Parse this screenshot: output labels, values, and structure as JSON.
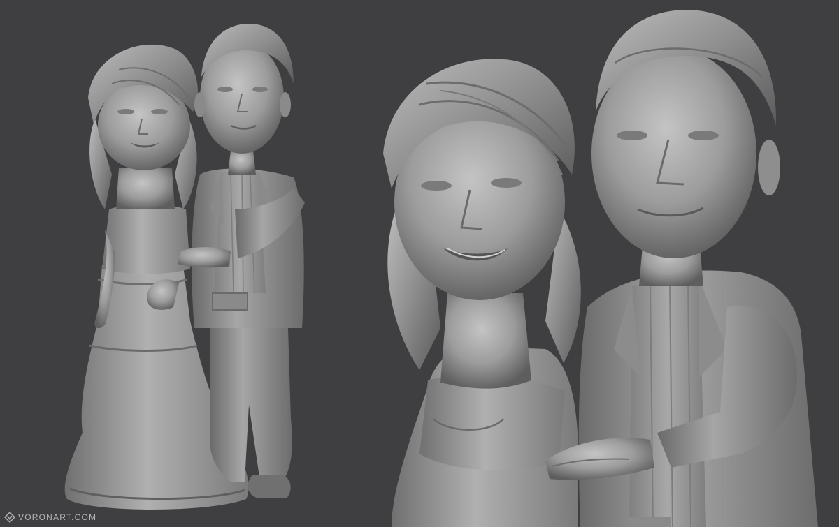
{
  "scene": {
    "background_color": "#3f3f41",
    "material_color": "#9a9a9a",
    "views": [
      "full-figure-view",
      "closeup-view"
    ]
  },
  "watermark": {
    "text": "VORONART.COM",
    "icon": "voronart-logo-icon"
  }
}
